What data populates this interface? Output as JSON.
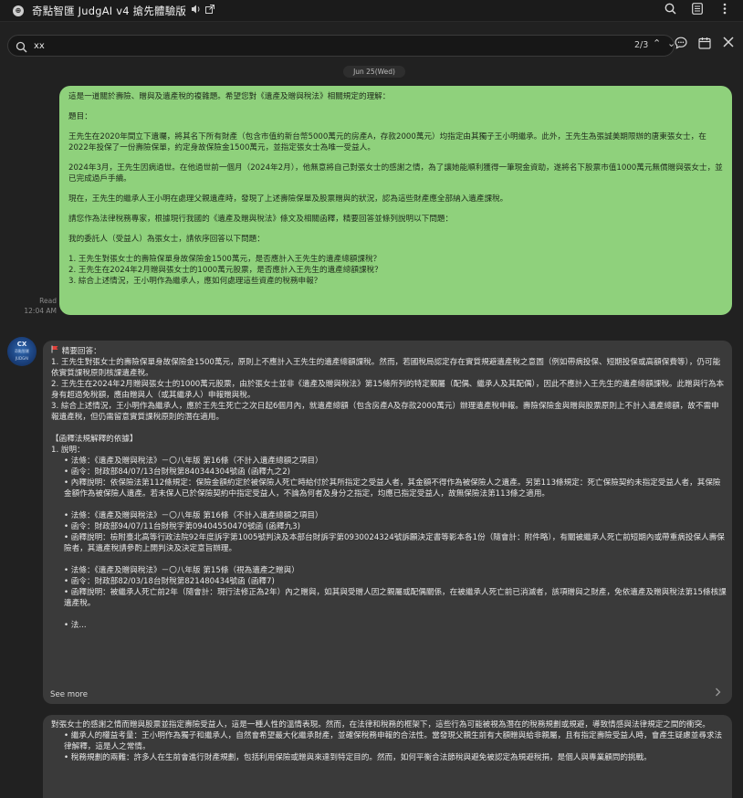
{
  "titlebar": {
    "title": "奇點智匯 JudgAI v4 搶先體驗版",
    "icons": [
      "shield-icon",
      "speaker-icon",
      "external-window-icon",
      "search-icon",
      "list-icon",
      "more-icon"
    ],
    "logo_glyph": "⊕"
  },
  "search": {
    "value": "xx",
    "placeholder": "",
    "match_count": "2/3",
    "up_glyph": "⌃",
    "down_glyph": "⌄"
  },
  "chat": {
    "date_chip": "Jun 25(Wed)",
    "user_message": {
      "status": "Read",
      "time": "12:04 AM",
      "paragraphs": [
        "這是一道關於壽險、贈與及遺產稅的複雜題。希望您對《遺產及贈與稅法》相關規定的理解：",
        "題目：",
        "王先生在2020年間立下遺囑，將其名下所有財產（包含市值約新台幣5000萬元的房產A，存款2000萬元）均指定由其獨子王小明繼承。此外，王先生為張誠美期限辦的唐東張女士，在2022年投保了一份壽險保單，約定身故保險金1500萬元，並指定張女士為唯一受益人。",
        "2024年3月，王先生因病過世。在他過世前一個月（2024年2月），他無意將自己對張女士的感謝之情，為了讓她能順利獲得一筆現金資助，遂將名下股票市值1000萬元無償贈與張女士，並已完成過戶手續。",
        "現在，王先生的繼承人王小明在處理父親遺產時，發現了上述壽險保單及股票贈與的狀況，認為這些財產應全部納入遺產課稅。",
        "請您作為法律稅務專家，根據現行我國的《遺產及贈與稅法》條文及相關函釋，精要回答並條列說明以下問題：",
        "我的委託人（受益人）為張女士，請依序回答以下問題："
      ],
      "questions": [
        "1. 王先生對張女士的壽險保單身故保險金1500萬元，是否應計入王先生的遺產總額課稅？",
        "2. 王先生在2024年2月贈與張女士的1000萬元股票，是否應計入王先生的遺產總額課稅？",
        "3. 綜合上述情況，王小明作為繼承人，應如何處理這些資產的稅務申報？"
      ]
    },
    "bot_avatar": {
      "line1": "CX",
      "line2": "奇點智匯",
      "line3": "JUDGAI"
    },
    "bot_message": {
      "header": "精要回答：",
      "summary": [
        "1. 王先生對張女士的壽險保單身故保險金1500萬元，原則上不應計入王先生的遺產總額課稅。然而，若國稅局認定存在實質規避遺產稅之意圖（例如帶病投保、短期投保或高額保費等），仍可能依實質課稅原則核課遺產稅。",
        "2. 王先生在2024年2月贈與張女士的1000萬元股票，由於張女士並非《遺產及贈與稅法》第15條所列的特定親屬（配偶、繼承人及其配偶），因此不應計入王先生的遺產總額課稅。此贈與行為本身有超過免稅額，應由贈與人（或其繼承人）申報贈與稅。",
        "3. 綜合上述情況，王小明作為繼承人，應於王先生死亡之次日起6個月內，就遺產總額（包含房產A及存款2000萬元）辦理遺產稅申報。壽險保險金與贈與股票原則上不計入遺產總額，故不需申報遺產稅，但仍需留意實質課稅原則的潛在適用。"
      ],
      "section_title": "【函釋法規解釋的依據】",
      "section_intro": "1. 說明：",
      "groups": [
        [
          "• 法條：《遺產及贈與稅法》－〇八年版 第16條（不計入遺產總額之項目）",
          "• 函令：財政部84/07/13台財稅第840344304號函 (函釋九之2)",
          "• 內釋說明：依保險法第112條規定：保險金額約定於被保險人死亡時給付於其所指定之受益人者，其金額不得作為被保險人之遺產。另第113條規定：死亡保險契約未指定受益人者，其保險金額作為被保險人遺產。若未保人已於保險契約中指定受益人，不論為何者及身分之指定，均應已指定受益人，故無保險法第113條之適用。"
        ],
        [
          "• 法條：《遺產及贈與稅法》－〇八年版 第16條（不計入遺產總額之項目）",
          "• 函令：財政部94/07/11台財稅字第09404550470號函 (函釋九3)",
          "• 函釋說明：檢附臺北高等行政法院92年度訴字第1005號判決及本部台財訴字第0930024324號訴願決定書等影本各1份（隨會計：附件略），有關被繼承人死亡前短期內或帶重病投保人壽保險者，其遺產稅請參酌上開判決及決定意旨辦理。"
        ],
        [
          "• 法條：《遺產及贈與稅法》－〇八年版 第15條（視為遺產之贈與）",
          "• 函令：財政部82/03/18台財稅第821480434號函 (函釋7)",
          "• 函釋說明：被繼承人死亡前2年（隨會計：現行法修正為2年）內之贈與，如其與受贈人因之親屬或配偶關係，在被繼承人死亡前已消滅者，該項贈與之財產，免依遺產及贈與稅法第15條核課遺產稅。"
        ],
        [
          "• 法..."
        ]
      ],
      "see_more": "See more"
    },
    "bot_message_2": {
      "lines": [
        "對張女士的感謝之情而贈與股票並指定壽險受益人，這是一種人性的溫情表現。然而，在法律和稅務的框架下，這些行為可能被視為潛在的稅務規劃或規避，導致情感與法律規定之間的衝突。",
        "• 繼承人的權益考量：王小明作為獨子和繼承人，自然會希望最大化繼承財產，並確保稅務申報的合法性。當發現父親生前有大額贈與給非親屬，且有指定壽險受益人時，會產生疑慮並尋求法律解釋，這是人之常情。",
        "• 稅務規劃的兩難：許多人在生前會進行財產規劃，包括利用保險或贈與來達到特定目的。然而，如何平衡合法節稅與避免被認定為規避稅捐，是個人與專業顧問的挑戰。"
      ]
    }
  }
}
